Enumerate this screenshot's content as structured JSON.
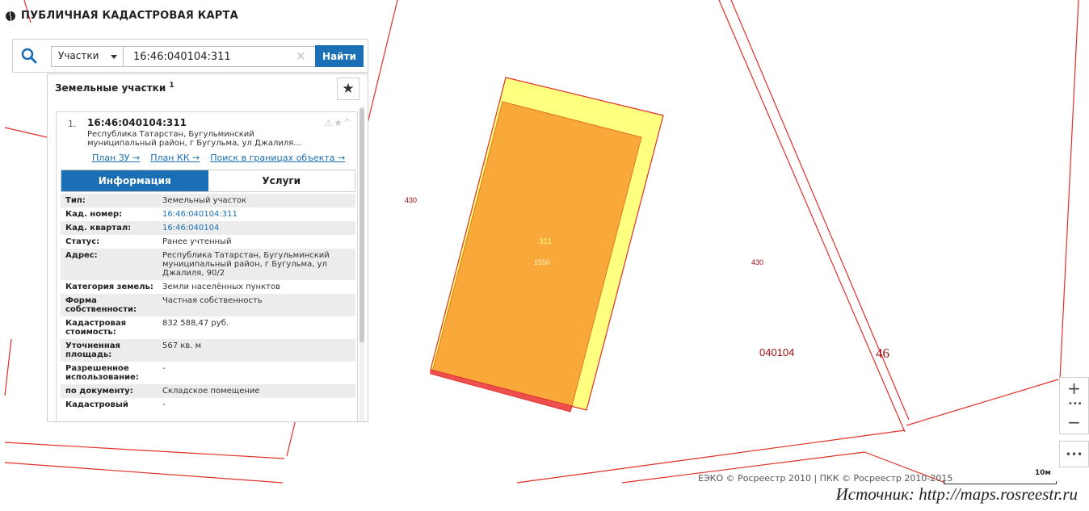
{
  "header": {
    "title": "ПУБЛИЧНАЯ КАДАСТРОВАЯ КАРТА"
  },
  "search": {
    "type_label": "Участки",
    "query": "16:46:040104:311",
    "clear_glyph": "×",
    "button_label": "Найти"
  },
  "panel": {
    "title": "Земельные участки",
    "count": "1",
    "favorite_glyph": "★"
  },
  "result": {
    "index": "1.",
    "number": "16:46:040104:311",
    "address_short": "Республика Татарстан, Бугульминский муниципальный район, г Бугульма, ул Джалиля...",
    "actions_glyph": "⚠★^",
    "links": {
      "plan_zu": "План ЗУ →",
      "plan_kk": "План КК →",
      "search_bounds": "Поиск в границах объекта →"
    },
    "tabs": {
      "info": "Информация",
      "services": "Услуги"
    },
    "info_rows": [
      {
        "key": "Тип:",
        "value": "Земельный участок"
      },
      {
        "key": "Кад. номер:",
        "value": "16:46:040104:311"
      },
      {
        "key": "Кад. квартал:",
        "value": "16:46:040104"
      },
      {
        "key": "Статус:",
        "value": "Ранее учтенный"
      },
      {
        "key": "Адрес:",
        "value": "Республика Татарстан, Бугульминский муниципальный район, г Бугульма, ул Джалиля, 90/2"
      },
      {
        "key": "Категория земель:",
        "value": "Земли населённых пунктов"
      },
      {
        "key": "Форма собственности:",
        "value": "Частная собственность"
      },
      {
        "key": "Кадастровая стоимость:",
        "value": "832 588,47 руб."
      },
      {
        "key": "Уточненная площадь:",
        "value": "567 кв. м"
      },
      {
        "key": "Разрешенное использование:",
        "value": "-"
      },
      {
        "key": "по документу:",
        "value": "Складское помещение"
      },
      {
        "key": "Кадастровый",
        "value": "-"
      }
    ]
  },
  "map": {
    "labels": {
      "parcel_430_left": "430",
      "parcel_430_right": "430",
      "parcel_311": "311",
      "area_1550": "1550",
      "quarter": "040104",
      "district": "46"
    },
    "colors": {
      "boundary": "#e0302a",
      "parcel_fill": "#f9a83a",
      "highlight_fill": "#ffff80",
      "accent": "#1a6fb5"
    }
  },
  "controls": {
    "zoom_in": "+",
    "zoom_out": "−",
    "dots": "•••",
    "more": "•••"
  },
  "footer": {
    "copyright": "ЕЭКО © Росреестр 2010 | ПКК © Росреестр 2010-2015",
    "scale": "10м",
    "source": "Источник: http://maps.rosreestr.ru"
  }
}
